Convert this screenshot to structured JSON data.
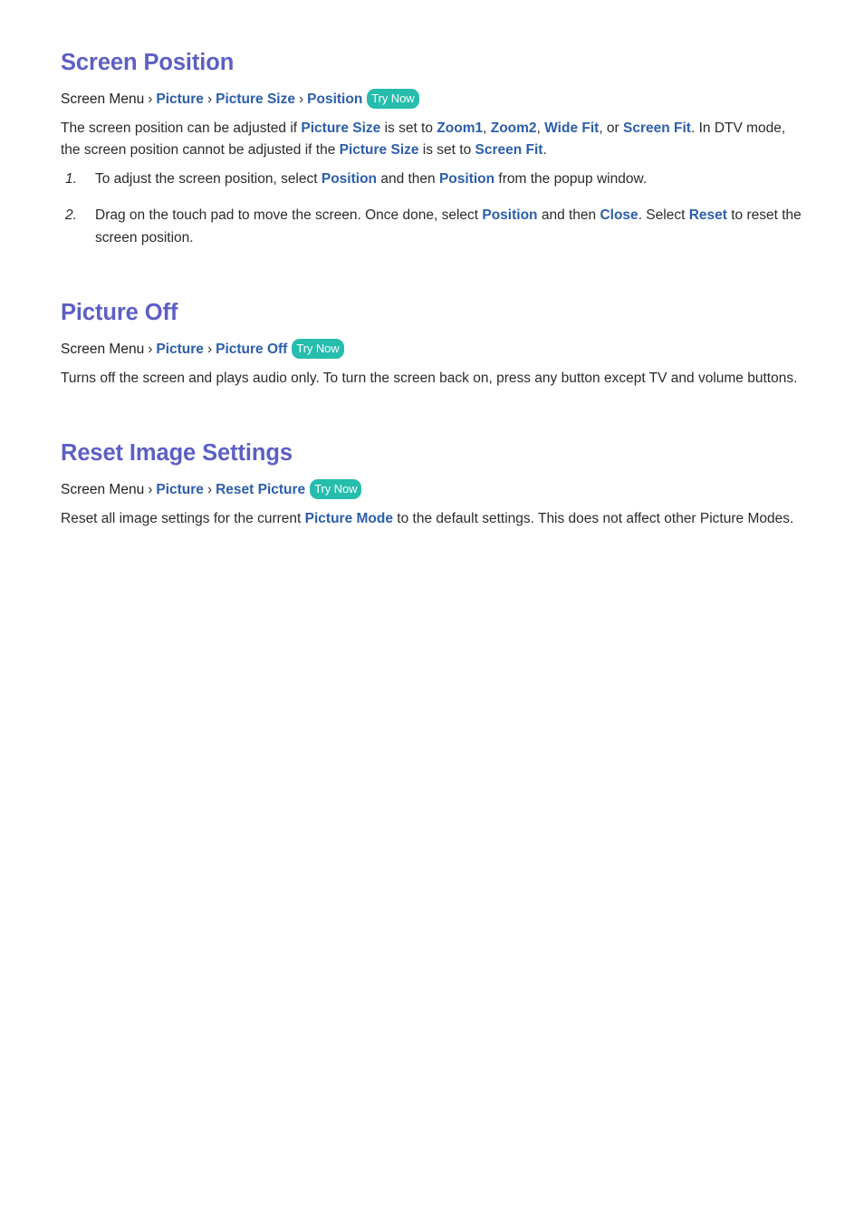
{
  "document": {
    "colors": {
      "heading": "#5c5fc4",
      "link": "#2c5eab",
      "badge_background": "#26bdad",
      "badge_text": "#ffffff",
      "body_text": "#2b2b2b",
      "page_background": "#ffffff"
    },
    "breadcrumb_root": "Screen Menu",
    "breadcrumb_separator": "›",
    "try_now_label": "Try Now"
  },
  "sections": [
    {
      "id": "screen-position",
      "title": "Screen Position",
      "breadcrumb": [
        "Picture",
        "Picture Size",
        "Position"
      ],
      "paragraph": {
        "part1": "The screen position can be adjusted if ",
        "kw1": "Picture Size",
        "part2": " is set to ",
        "kw2": "Zoom1",
        "part3": ", ",
        "kw3": "Zoom2",
        "part4": ", ",
        "kw4": "Wide Fit",
        "part5": ", or ",
        "kw5": "Screen Fit",
        "part6": ". In DTV mode, the screen position cannot be adjusted if the ",
        "kw6": "Picture Size",
        "part7": " is set to ",
        "kw7": "Screen Fit",
        "part8": "."
      },
      "steps": [
        {
          "number": "1.",
          "part1": "To adjust the screen position, select ",
          "kw1": "Position",
          "part2": " and then ",
          "kw2": "Position",
          "part3": " from the popup window."
        },
        {
          "number": "2.",
          "part1": "Drag on the touch pad to move the screen. Once done, select ",
          "kw1": "Position",
          "part2": " and then ",
          "kw2": "Close",
          "part3": ". Select ",
          "kw3": "Reset",
          "part4": " to reset the screen position."
        }
      ]
    },
    {
      "id": "picture-off",
      "title": "Picture Off",
      "breadcrumb": [
        "Picture",
        "Picture Off"
      ],
      "paragraph": {
        "part1": "Turns off the screen and plays audio only. To turn the screen back on, press any button except TV and volume buttons."
      }
    },
    {
      "id": "reset-image-settings",
      "title": "Reset Image Settings",
      "breadcrumb": [
        "Picture",
        "Reset Picture"
      ],
      "paragraph": {
        "part1": "Reset all image settings for the current ",
        "kw1": "Picture Mode",
        "part2": " to the default settings. This does not affect other Picture Modes."
      }
    }
  ]
}
